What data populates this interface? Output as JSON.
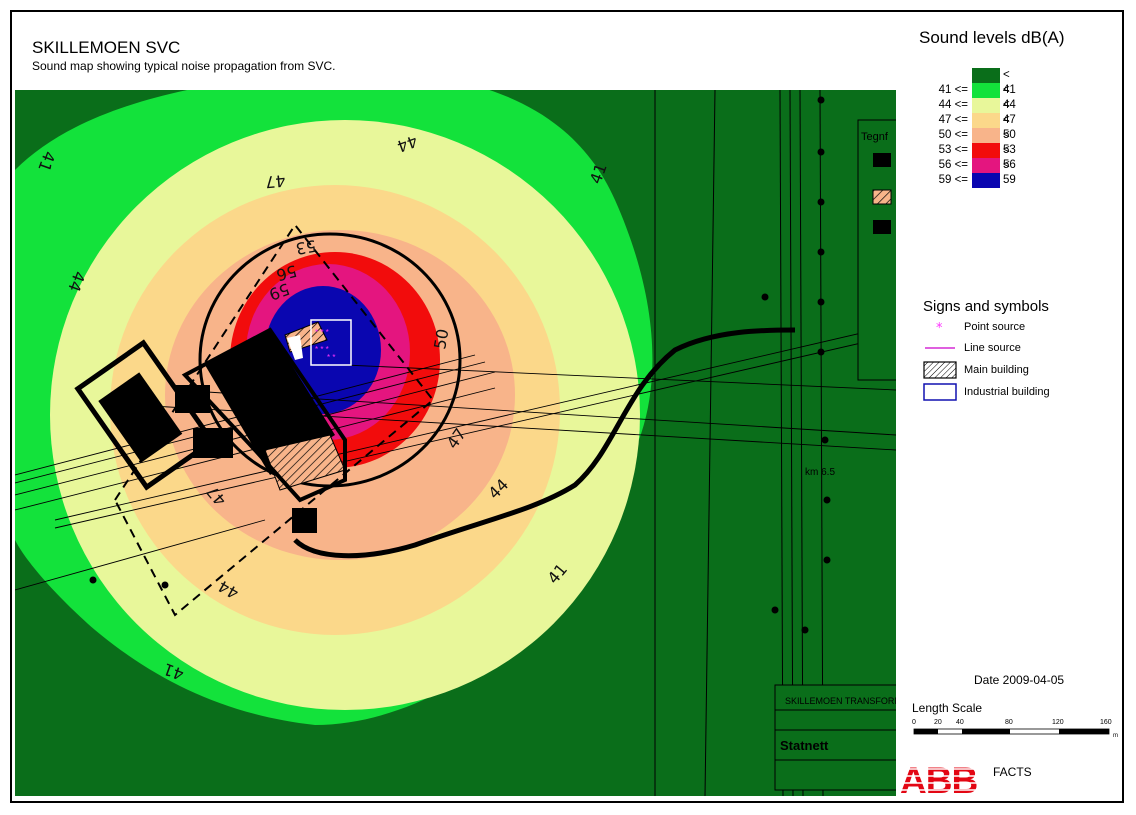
{
  "header": {
    "title": "SKILLEMOEN SVC",
    "subtitle": "Sound map showing typical noise propagation from SVC."
  },
  "legend": {
    "title": "Sound levels dB(A)",
    "bands": [
      {
        "low": "",
        "high": "< 41",
        "color": "#0a6e1a"
      },
      {
        "low": "41 <=",
        "high": "< 44",
        "color": "#13e23b"
      },
      {
        "low": "44 <=",
        "high": "< 47",
        "color": "#e8f79a"
      },
      {
        "low": "47 <=",
        "high": "< 50",
        "color": "#fbd88a"
      },
      {
        "low": "50 <=",
        "high": "< 53",
        "color": "#f8b48a"
      },
      {
        "low": "53 <=",
        "high": "< 56",
        "color": "#f20c0c"
      },
      {
        "low": "56 <=",
        "high": "< 59",
        "color": "#e4157f"
      },
      {
        "low": "59 <=",
        "high": "",
        "color": "#0a06b0"
      }
    ]
  },
  "signs": {
    "title": "Signs and symbols",
    "items": [
      {
        "label": "Point source",
        "icon": "point-source-icon"
      },
      {
        "label": "Line source",
        "icon": "line-source-icon"
      },
      {
        "label": "Main building",
        "icon": "main-building-icon"
      },
      {
        "label": "Industrial building",
        "icon": "industrial-building-icon"
      }
    ]
  },
  "contour_labels": {
    "c41_a": "41",
    "c41_b": "41",
    "c41_c": "41",
    "c41_d": "41",
    "c44_a": "44",
    "c44_b": "44",
    "c44_c": "44",
    "c44_d": "44",
    "c47_a": "47",
    "c47_b": "47",
    "c47_c": "47",
    "c50": "50",
    "c53": "53",
    "c56": "56",
    "c59": "59"
  },
  "map_text": {
    "tegnf": "Tegnf",
    "drawing_title": "SKILLEMOEN TRANSFORMATORS",
    "statnett": "Statnett",
    "km": "km 6.5"
  },
  "footer": {
    "date": "Date 2009-04-05",
    "scale_title": "Length Scale",
    "scale_ticks": [
      "0",
      "20",
      "40",
      "80",
      "120",
      "160"
    ],
    "scale_unit": "m",
    "logo": "ABB",
    "facts": "FACTS"
  }
}
